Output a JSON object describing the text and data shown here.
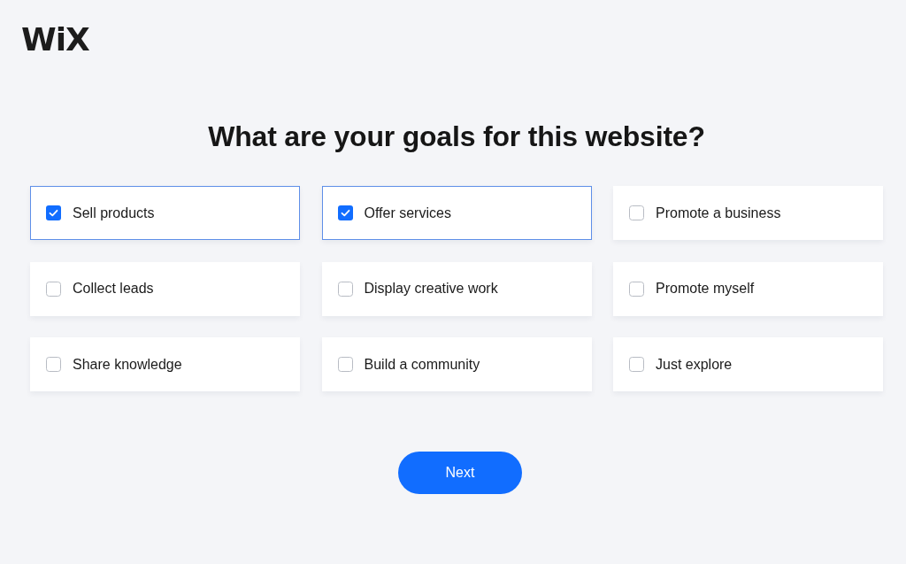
{
  "logo": "WiX",
  "heading": "What are your goals for this website?",
  "options": [
    {
      "label": "Sell products",
      "checked": true
    },
    {
      "label": "Offer services",
      "checked": true
    },
    {
      "label": "Promote a business",
      "checked": false
    },
    {
      "label": "Collect leads",
      "checked": false
    },
    {
      "label": "Display creative work",
      "checked": false
    },
    {
      "label": "Promote myself",
      "checked": false
    },
    {
      "label": "Share knowledge",
      "checked": false
    },
    {
      "label": "Build a community",
      "checked": false
    },
    {
      "label": "Just explore",
      "checked": false
    }
  ],
  "next_button": "Next"
}
